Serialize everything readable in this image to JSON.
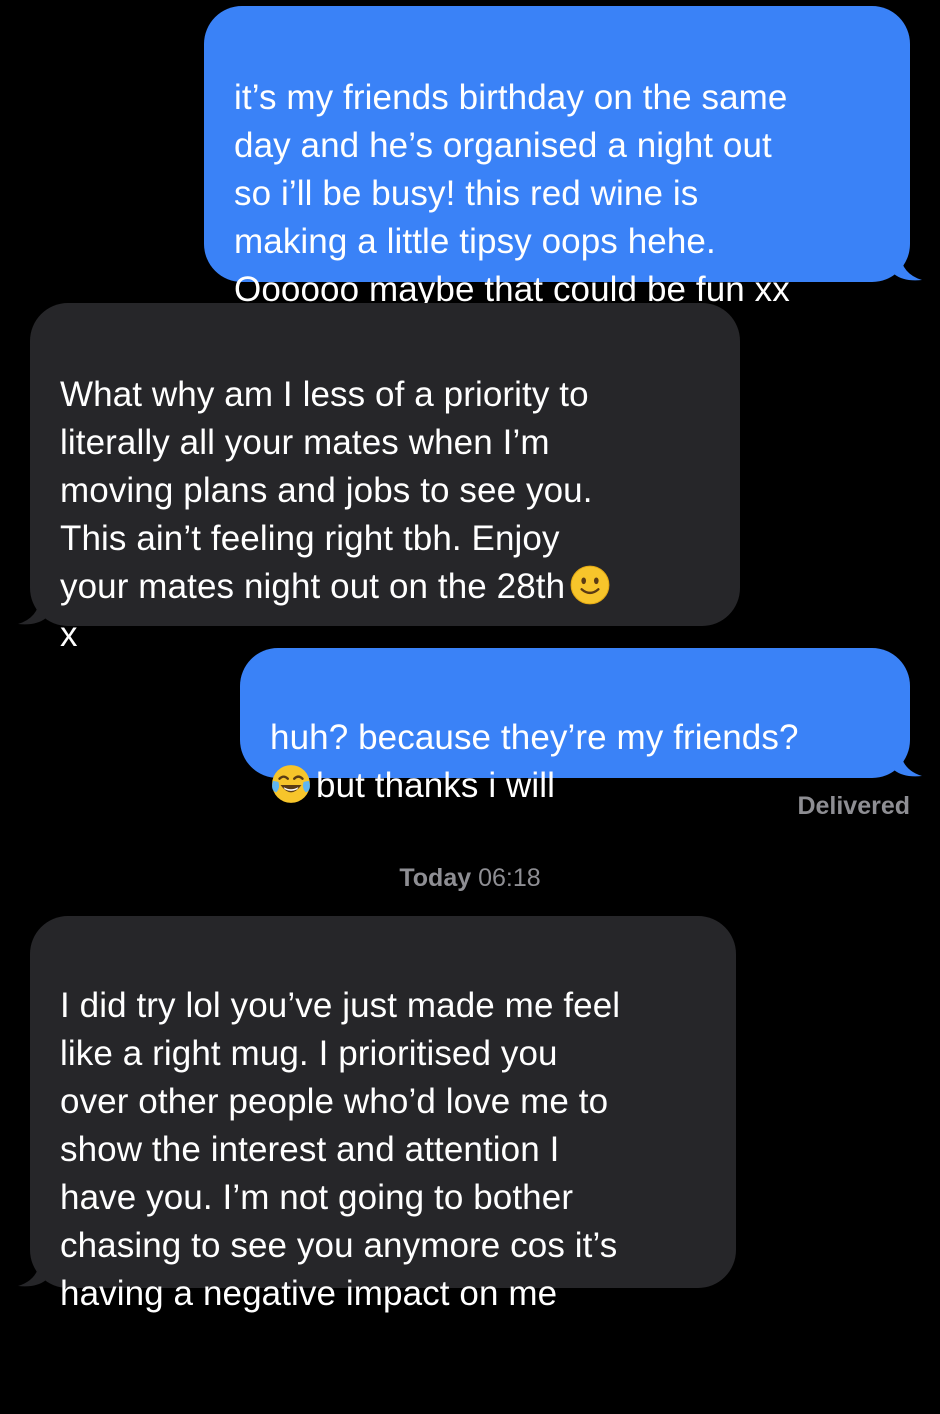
{
  "conversation": {
    "messages": [
      {
        "direction": "sent",
        "text": "it’s my friends birthday on the same\nday and he’s organised a night out\nso i’ll be busy! this red wine is\nmaking a little tipsy oops hehe.\nOooooo maybe that could be fun xx"
      },
      {
        "direction": "received",
        "text_before_emoji": "What why am I less of a priority to\nliterally all your mates when I’m\nmoving plans and jobs to see you.\nThis ain’t feeling right tbh. Enjoy\nyour mates night out on the 28th",
        "emoji": "slightly-smiling-face",
        "text_after_emoji": "\nx"
      },
      {
        "direction": "sent",
        "text_before_emoji": "huh? because they’re my friends?\n",
        "emoji": "face-with-tears-of-joy",
        "text_after_emoji": "but thanks i will"
      },
      {
        "direction": "received",
        "text": "I did try lol you’ve just made me feel\nlike a right mug. I prioritised you\nover other people who’d love me to\nshow the interest and attention I\nhave you. I’m not going to bother\nchasing to see you anymore cos it’s\nhaving a negative impact on me"
      }
    ],
    "delivered_status": "Delivered",
    "timestamp": {
      "day": "Today",
      "time": "06:18"
    }
  },
  "colors": {
    "background": "#000000",
    "sent_bubble": "#3a82f7",
    "received_bubble": "#262629",
    "message_text": "#ffffff",
    "meta_text": "#8e8e93"
  }
}
